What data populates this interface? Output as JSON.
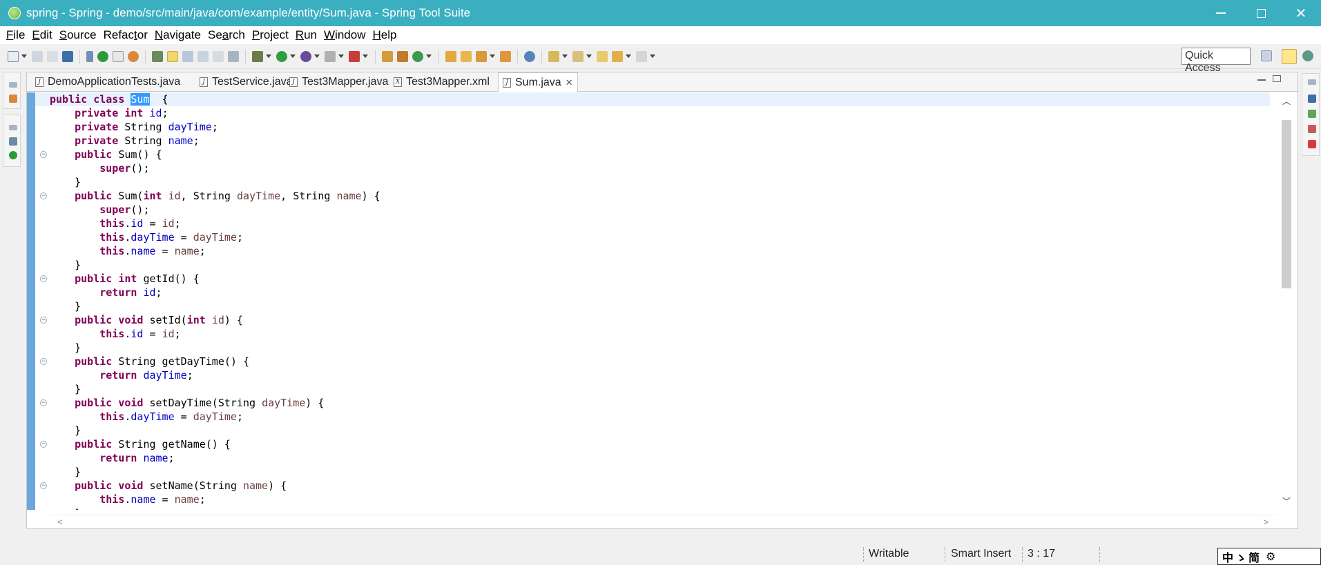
{
  "window": {
    "title": "spring - Spring - demo/src/main/java/com/example/entity/Sum.java - Spring Tool Suite"
  },
  "menu": [
    {
      "accel": "F",
      "rest": "ile"
    },
    {
      "accel": "E",
      "rest": "dit"
    },
    {
      "accel": "S",
      "rest": "ource"
    },
    {
      "pre": "Refac",
      "accel": "t",
      "rest": "or"
    },
    {
      "accel": "N",
      "rest": "avigate"
    },
    {
      "pre": "Se",
      "accel": "a",
      "rest": "rch"
    },
    {
      "accel": "P",
      "rest": "roject"
    },
    {
      "accel": "R",
      "rest": "un"
    },
    {
      "accel": "W",
      "rest": "indow"
    },
    {
      "accel": "H",
      "rest": "elp"
    }
  ],
  "toolbar": {
    "quick_access": "Quick Access"
  },
  "tabs": [
    {
      "label": "DemoApplicationTests.java",
      "icon": "J"
    },
    {
      "label": "TestService.java",
      "icon": "J"
    },
    {
      "label": "Test3Mapper.java",
      "icon": "J"
    },
    {
      "label": "Test3Mapper.xml",
      "icon": "X"
    },
    {
      "label": "Sum.java",
      "icon": "J",
      "active": true
    }
  ],
  "editor": {
    "file": "Sum.java",
    "selected_text": "Sum",
    "lines": [
      [
        [
          "kw",
          "public class "
        ],
        [
          "sel",
          "Sum"
        ],
        [
          "",
          "  {"
        ]
      ],
      [
        [
          "",
          "    "
        ],
        [
          "kw",
          "private int "
        ],
        [
          "fld",
          "id"
        ],
        [
          "",
          ";"
        ]
      ],
      [
        [
          "",
          "    "
        ],
        [
          "kw",
          "private "
        ],
        [
          "",
          "String "
        ],
        [
          "fld",
          "dayTime"
        ],
        [
          "",
          ";"
        ]
      ],
      [
        [
          "",
          "    "
        ],
        [
          "kw",
          "private "
        ],
        [
          "",
          "String "
        ],
        [
          "fld",
          "name"
        ],
        [
          "",
          ";"
        ]
      ],
      [
        [
          "",
          "    "
        ],
        [
          "kw",
          "public "
        ],
        [
          "",
          "Sum() {"
        ]
      ],
      [
        [
          "",
          "        "
        ],
        [
          "kw",
          "super"
        ],
        [
          "",
          "();"
        ]
      ],
      [
        [
          "",
          "    }"
        ]
      ],
      [
        [
          "",
          "    "
        ],
        [
          "kw",
          "public "
        ],
        [
          "",
          "Sum("
        ],
        [
          "kw",
          "int "
        ],
        [
          "par",
          "id"
        ],
        [
          "",
          ", String "
        ],
        [
          "par",
          "dayTime"
        ],
        [
          "",
          ", String "
        ],
        [
          "par",
          "name"
        ],
        [
          "",
          ") {"
        ]
      ],
      [
        [
          "",
          "        "
        ],
        [
          "kw",
          "super"
        ],
        [
          "",
          "();"
        ]
      ],
      [
        [
          "",
          "        "
        ],
        [
          "kw",
          "this"
        ],
        [
          "",
          "."
        ],
        [
          "fld",
          "id"
        ],
        [
          "",
          " = "
        ],
        [
          "par",
          "id"
        ],
        [
          "",
          ";"
        ]
      ],
      [
        [
          "",
          "        "
        ],
        [
          "kw",
          "this"
        ],
        [
          "",
          "."
        ],
        [
          "fld",
          "dayTime"
        ],
        [
          "",
          " = "
        ],
        [
          "par",
          "dayTime"
        ],
        [
          "",
          ";"
        ]
      ],
      [
        [
          "",
          "        "
        ],
        [
          "kw",
          "this"
        ],
        [
          "",
          "."
        ],
        [
          "fld",
          "name"
        ],
        [
          "",
          " = "
        ],
        [
          "par",
          "name"
        ],
        [
          "",
          ";"
        ]
      ],
      [
        [
          "",
          "    }"
        ]
      ],
      [
        [
          "",
          "    "
        ],
        [
          "kw",
          "public int "
        ],
        [
          "",
          "getId() {"
        ]
      ],
      [
        [
          "",
          "        "
        ],
        [
          "kw",
          "return "
        ],
        [
          "fld",
          "id"
        ],
        [
          "",
          ";"
        ]
      ],
      [
        [
          "",
          "    }"
        ]
      ],
      [
        [
          "",
          "    "
        ],
        [
          "kw",
          "public void "
        ],
        [
          "",
          "setId("
        ],
        [
          "kw",
          "int "
        ],
        [
          "par",
          "id"
        ],
        [
          "",
          ") {"
        ]
      ],
      [
        [
          "",
          "        "
        ],
        [
          "kw",
          "this"
        ],
        [
          "",
          "."
        ],
        [
          "fld",
          "id"
        ],
        [
          "",
          " = "
        ],
        [
          "par",
          "id"
        ],
        [
          "",
          ";"
        ]
      ],
      [
        [
          "",
          "    }"
        ]
      ],
      [
        [
          "",
          "    "
        ],
        [
          "kw",
          "public "
        ],
        [
          "",
          "String getDayTime() {"
        ]
      ],
      [
        [
          "",
          "        "
        ],
        [
          "kw",
          "return "
        ],
        [
          "fld",
          "dayTime"
        ],
        [
          "",
          ";"
        ]
      ],
      [
        [
          "",
          "    }"
        ]
      ],
      [
        [
          "",
          "    "
        ],
        [
          "kw",
          "public void "
        ],
        [
          "",
          "setDayTime(String "
        ],
        [
          "par",
          "dayTime"
        ],
        [
          "",
          ") {"
        ]
      ],
      [
        [
          "",
          "        "
        ],
        [
          "kw",
          "this"
        ],
        [
          "",
          "."
        ],
        [
          "fld",
          "dayTime"
        ],
        [
          "",
          " = "
        ],
        [
          "par",
          "dayTime"
        ],
        [
          "",
          ";"
        ]
      ],
      [
        [
          "",
          "    }"
        ]
      ],
      [
        [
          "",
          "    "
        ],
        [
          "kw",
          "public "
        ],
        [
          "",
          "String getName() {"
        ]
      ],
      [
        [
          "",
          "        "
        ],
        [
          "kw",
          "return "
        ],
        [
          "fld",
          "name"
        ],
        [
          "",
          ";"
        ]
      ],
      [
        [
          "",
          "    }"
        ]
      ],
      [
        [
          "",
          "    "
        ],
        [
          "kw",
          "public void "
        ],
        [
          "",
          "setName(String "
        ],
        [
          "par",
          "name"
        ],
        [
          "",
          ") {"
        ]
      ],
      [
        [
          "",
          "        "
        ],
        [
          "kw",
          "this"
        ],
        [
          "",
          "."
        ],
        [
          "fld",
          "name"
        ],
        [
          "",
          " = "
        ],
        [
          "par",
          "name"
        ],
        [
          "",
          ";"
        ]
      ],
      [
        [
          "",
          "    }"
        ]
      ]
    ],
    "fold_lines": [
      4,
      7,
      13,
      16,
      19,
      22,
      25,
      28
    ]
  },
  "status": {
    "writable": "Writable",
    "insert_mode": "Smart Insert",
    "position": "3 : 17"
  },
  "ime": {
    "text": "中ゝ简"
  }
}
